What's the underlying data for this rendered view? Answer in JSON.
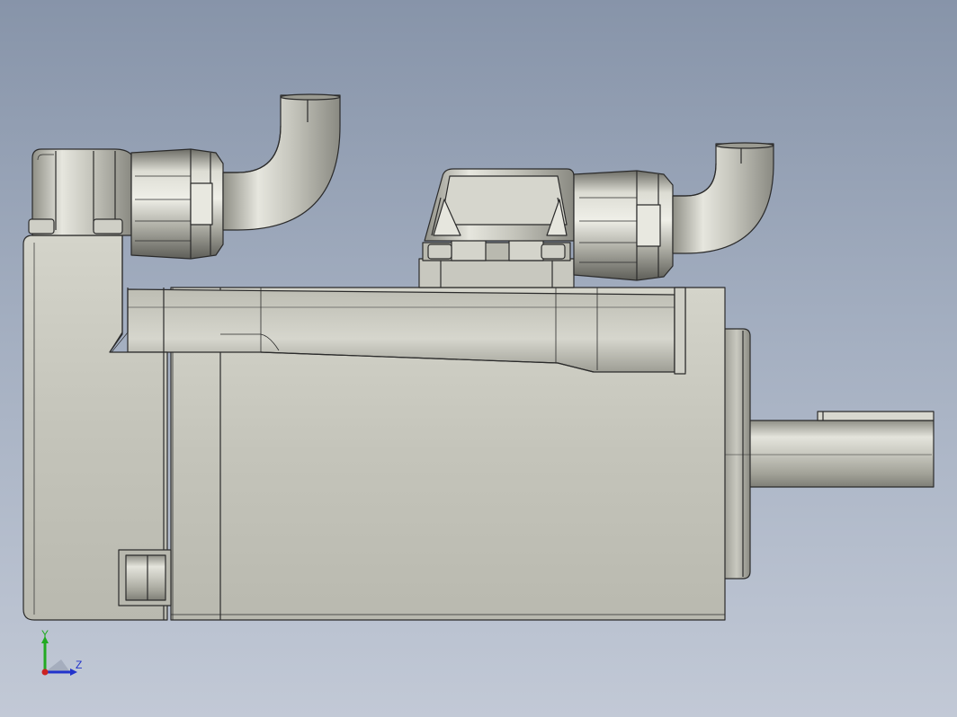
{
  "viewport": {
    "background_top": "#8794a9",
    "background_bottom": "#c2c9d6",
    "model_description": "servo-motor-side-view"
  },
  "triad": {
    "y_label": "Y",
    "z_label": "Z",
    "y_color": "#22aa22",
    "z_color": "#2233cc",
    "x_color": "#cc2222"
  }
}
